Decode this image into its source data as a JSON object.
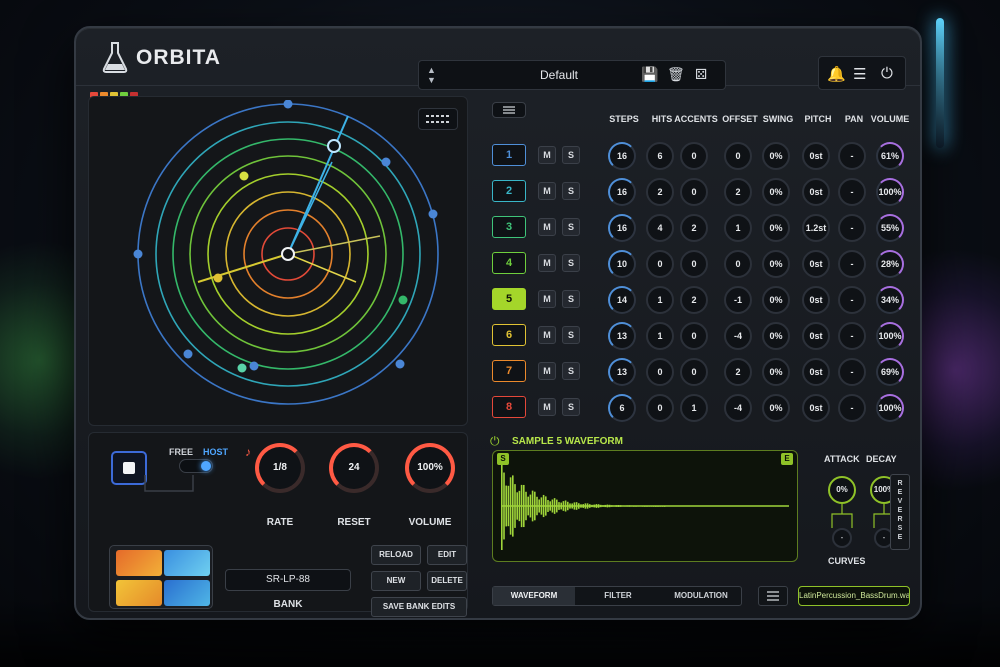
{
  "app": {
    "title": "ORBITA"
  },
  "preset": {
    "name": "Default"
  },
  "icons": {
    "logo": "flask-icon",
    "save": "save-icon",
    "delete": "trash-icon",
    "random": "dice-icon",
    "bell": "bell-icon",
    "menu": "hamburger-icon",
    "power": "power-icon"
  },
  "sequencer": {
    "headers": [
      "STEPS",
      "HITS",
      "ACCENTS",
      "OFFSET",
      "SWING",
      "PITCH",
      "PAN",
      "VOLUME"
    ],
    "mute_label": "M",
    "solo_label": "S",
    "tracks": [
      {
        "num": "1",
        "color": "#4f8fd8",
        "steps": "16",
        "hits": "6",
        "accents": "0",
        "offset": "0",
        "swing": "0%",
        "pitch": "0st",
        "pan": "-",
        "volume": "61%"
      },
      {
        "num": "2",
        "color": "#39b6c8",
        "steps": "16",
        "hits": "2",
        "accents": "0",
        "offset": "2",
        "swing": "0%",
        "pitch": "0st",
        "pan": "-",
        "volume": "100%"
      },
      {
        "num": "3",
        "color": "#3fc47a",
        "steps": "16",
        "hits": "4",
        "accents": "2",
        "offset": "1",
        "swing": "0%",
        "pitch": "1.2st",
        "pan": "-",
        "volume": "55%"
      },
      {
        "num": "4",
        "color": "#6fcf3d",
        "steps": "10",
        "hits": "0",
        "accents": "0",
        "offset": "0",
        "swing": "0%",
        "pitch": "0st",
        "pan": "-",
        "volume": "28%"
      },
      {
        "num": "5",
        "color": "#a4d62a",
        "steps": "14",
        "hits": "1",
        "accents": "2",
        "offset": "-1",
        "swing": "0%",
        "pitch": "0st",
        "pan": "-",
        "volume": "34%"
      },
      {
        "num": "6",
        "color": "#e0c234",
        "steps": "13",
        "hits": "1",
        "accents": "0",
        "offset": "-4",
        "swing": "0%",
        "pitch": "0st",
        "pan": "-",
        "volume": "100%"
      },
      {
        "num": "7",
        "color": "#ec8a2c",
        "steps": "13",
        "hits": "0",
        "accents": "0",
        "offset": "2",
        "swing": "0%",
        "pitch": "0st",
        "pan": "-",
        "volume": "69%"
      },
      {
        "num": "8",
        "color": "#e5483a",
        "steps": "6",
        "hits": "0",
        "accents": "1",
        "offset": "-4",
        "swing": "0%",
        "pitch": "0st",
        "pan": "-",
        "volume": "100%"
      }
    ]
  },
  "transport": {
    "free_label": "FREE",
    "host_label": "HOST",
    "mode": "host"
  },
  "master": {
    "rate_value": "1/8",
    "rate_label": "RATE",
    "reset_value": "24",
    "reset_label": "RESET",
    "volume_value": "100%",
    "volume_label": "VOLUME"
  },
  "bank": {
    "name": "SR-LP-88",
    "label": "BANK",
    "reload": "RELOAD",
    "edit": "EDIT",
    "new": "NEW",
    "delete": "DELETE",
    "save": "SAVE BANK EDITS"
  },
  "sample": {
    "title": "SAMPLE 5 WAVEFORM",
    "start_tag": "S",
    "end_tag": "E",
    "attack_label": "ATTACK",
    "decay_label": "DECAY",
    "attack_value": "0%",
    "decay_value": "100%",
    "attack_curve": "-",
    "decay_curve": "-",
    "curves_label": "CURVES",
    "reverse_label": "REVERSE",
    "tabs": [
      "WAVEFORM",
      "FILTER",
      "MODULATION"
    ],
    "active_tab": 0,
    "file": "LatinPercussion_BassDrum.wav"
  },
  "colors": {
    "accent_red": "#ff5a44",
    "accent_green": "#8fc228",
    "accent_blue": "#4f8fd8"
  }
}
